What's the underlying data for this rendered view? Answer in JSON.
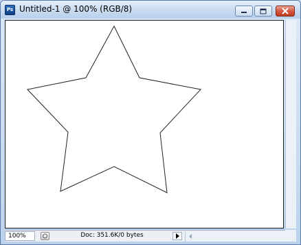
{
  "window": {
    "title": "Untitled-1 @ 100% (RGB/8)",
    "app_icon_text": "Ps"
  },
  "statusbar": {
    "zoom": "100%",
    "doc_info": "Doc: 351.6K/0 bytes"
  },
  "canvas": {
    "background": "#ffffff",
    "shape": "star-path"
  },
  "colors": {
    "title_bar": "#c9dcf1",
    "close_button": "#c84a2f",
    "star_outline": "#222222"
  }
}
